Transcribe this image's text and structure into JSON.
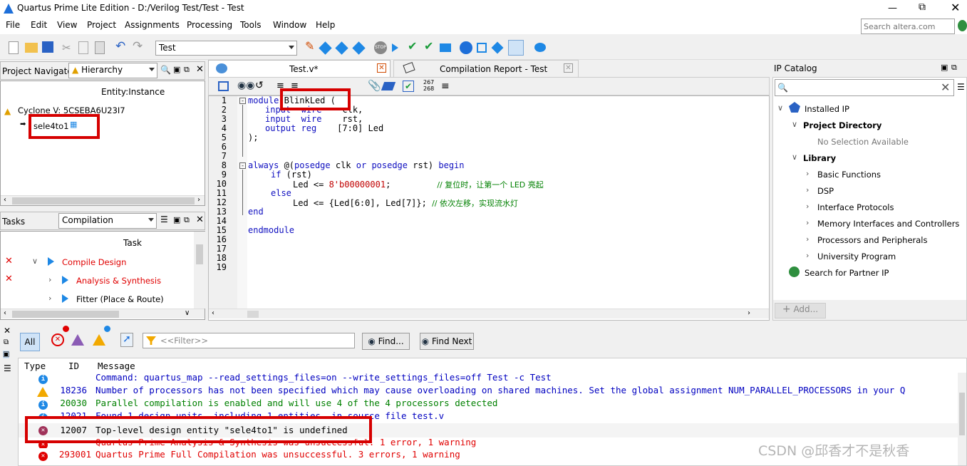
{
  "window": {
    "title": "Quartus Prime Lite Edition - D:/Verilog Test/Test - Test"
  },
  "menu": [
    "File",
    "Edit",
    "View",
    "Project",
    "Assignments",
    "Processing",
    "Tools",
    "Window",
    "Help"
  ],
  "search": {
    "placeholder": "Search altera.com"
  },
  "toolbar": {
    "project_select": "Test"
  },
  "nav": {
    "title": "Project Navigator",
    "mode": "Hierarchy",
    "column": "Entity:Instance",
    "device": "Cyclone V: 5CSEBA6U23I7",
    "top_entity": "sele4to1"
  },
  "tasks": {
    "title": "Tasks",
    "mode": "Compilation",
    "column": "Task",
    "items": [
      "Compile Design",
      "Analysis & Synthesis",
      "Fitter (Place & Route)"
    ]
  },
  "editor": {
    "tabs": [
      "Test.v*",
      "Compilation Report - Test"
    ],
    "line_numbers": [
      "1",
      "2",
      "3",
      "4",
      "5",
      "6",
      "7",
      "8",
      "9",
      "10",
      "11",
      "12",
      "13",
      "14",
      "15",
      "16",
      "17",
      "18",
      "19"
    ],
    "code": {
      "l1_kw": "module",
      "l1_name": "BlinkLed (",
      "l2_kw": "input  wire",
      "l2_sig": "    clk,",
      "l3_kw": "input  wire",
      "l3_sig": "    rst,",
      "l4_kw": "output reg",
      "l4_rng": "    [7:0] Led",
      "l5": ");",
      "l8_kw": "always",
      "l8_rest1": " @(",
      "l8_kw2": "posedge",
      "l8_rest2": " clk ",
      "l8_kw3": "or",
      "l8_rest3": " ",
      "l8_kw4": "posedge",
      "l8_rest4": " rst) ",
      "l8_kw5": "begin",
      "l9_kw": "if",
      "l9_rest": " (rst)",
      "l10_a": "Led <= ",
      "l10_num": "8'b00000001",
      "l10_b": ";         ",
      "l10_cm": "// 复位时，让第一个 LED 亮起",
      "l11_kw": "else",
      "l12_a": "Led <= {Led[6:0], Led[7]}; ",
      "l12_cm": "// 依次左移，实现流水灯",
      "l13_kw": "end",
      "l15_kw": "endmodule"
    }
  },
  "ip": {
    "title": "IP Catalog",
    "installed": "Installed IP",
    "project_dir": "Project Directory",
    "no_selection": "No Selection Available",
    "library": "Library",
    "items": [
      "Basic Functions",
      "DSP",
      "Interface Protocols",
      "Memory Interfaces and Controllers",
      "Processors and Peripherals",
      "University Program"
    ],
    "partner": "Search for Partner IP",
    "add": "Add..."
  },
  "messages": {
    "filter_all": "All",
    "filter_placeholder": "<<Filter>>",
    "find": "Find...",
    "find_next": "Find Next",
    "headers": {
      "type": "Type",
      "id": "ID",
      "message": "Message"
    },
    "rows": [
      {
        "kind": "info",
        "id": "",
        "text": "Command: quartus_map --read_settings_files=on --write_settings_files=off Test -c Test"
      },
      {
        "kind": "warning",
        "id": "18236",
        "text": "Number of processors has not been specified which may cause overloading on shared machines.  Set the global assignment NUM_PARALLEL_PROCESSORS in your Q"
      },
      {
        "kind": "info",
        "id": "20030",
        "text": "Parallel compilation is enabled and will use 4 of the 4 processors detected"
      },
      {
        "kind": "info",
        "id": "12021",
        "text": "Found 1 design units, including 1 entities, in source file test.v"
      },
      {
        "kind": "error",
        "id": "12007",
        "text": "Top-level design entity \"sele4to1\" is undefined"
      },
      {
        "kind": "error",
        "id": "",
        "text": "Quartus Prime Analysis & Synthesis was unsuccessful. 1 error, 1 warning"
      },
      {
        "kind": "error",
        "id": "293001",
        "text": "Quartus Prime Full Compilation was unsuccessful. 3 errors, 1 warning"
      }
    ]
  },
  "watermark": "CSDN @邱香才不是秋香",
  "colors": {
    "accent": "#1e88e5",
    "error": "#e00000",
    "keyword": "#1010c0",
    "comment": "#008000",
    "highlight_box": "#d60000"
  }
}
